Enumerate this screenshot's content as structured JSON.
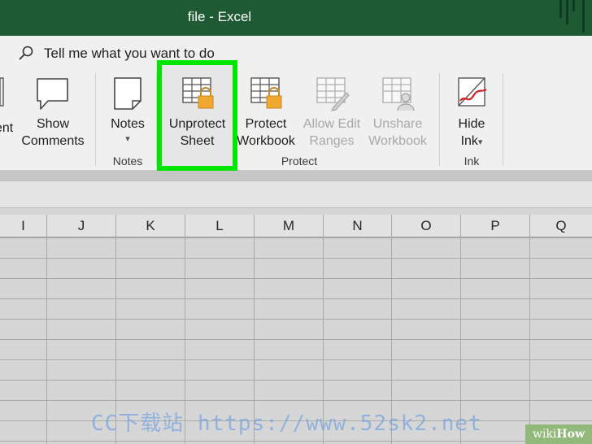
{
  "window": {
    "title": "file  -  Excel"
  },
  "tellme": {
    "text": "Tell me what you want to do"
  },
  "ribbon": {
    "comments_partial": "ent",
    "show_comments": {
      "line1": "Show",
      "line2": "Comments"
    },
    "notes": {
      "label": "Notes",
      "caret": "▾"
    },
    "unprotect_sheet": {
      "line1": "Unprotect",
      "line2": "Sheet"
    },
    "protect_workbook": {
      "line1": "Protect",
      "line2": "Workbook"
    },
    "allow_edit_ranges": {
      "line1": "Allow Edit",
      "line2": "Ranges"
    },
    "unshare_workbook": {
      "line1": "Unshare",
      "line2": "Workbook"
    },
    "hide_ink": {
      "line1": "Hide",
      "line2": "Ink",
      "caret": "▾"
    },
    "groups": {
      "notes": "Notes",
      "protect": "Protect",
      "ink": "Ink"
    }
  },
  "columns": [
    "I",
    "J",
    "K",
    "L",
    "M",
    "N",
    "O",
    "P",
    "Q"
  ],
  "watermark": "CC下载站 https://www.52sk2.net",
  "badge": {
    "wiki": "wiki",
    "how": "How"
  },
  "colors": {
    "titlebar": "#1e5b35",
    "highlight": "#00e600",
    "lock": "#f0a830"
  }
}
